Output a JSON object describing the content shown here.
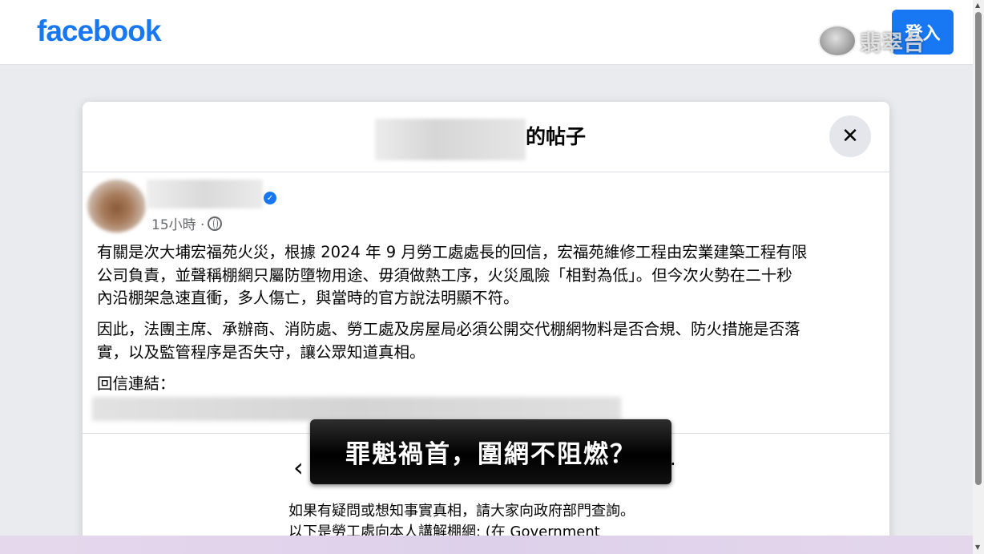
{
  "header": {
    "logo_text": "facebook",
    "login_label": "登入",
    "watermark_text": "翡翠台"
  },
  "modal": {
    "title_suffix": "的帖子",
    "close_icon": "close-icon"
  },
  "post": {
    "time": "15小時 ·",
    "privacy_icon": "globe-icon",
    "verified_icon": "verified-badge-icon",
    "paragraphs": [
      [
        "有關是次大埔宏福苑火災，根據 2024 年 9 月勞工處處長的回信，宏福苑維修工程由宏業建築工程有限",
        "公司負責，並聲稱棚網只屬防墮物用途、毋須做熱工序，火災風險「相對為低」。但今次火勢在二十秒",
        "內沿棚架急速直衝，多人傷亡，與當時的官方說法明顯不符。"
      ],
      [
        "因此，法團主席、承辦商、消防處、勞工處及房屋局必須公開交代棚網物料是否合規、防火措施是否落",
        "實，以及監管程序是否失守，讓公眾知道真相。"
      ],
      [
        "回信連結："
      ]
    ],
    "preview_lines": [
      "如果有疑問或想知事實真相，請大家向政府部門查詢。",
      "以下是勞工處向本人講解棚網: (在 Government"
    ]
  },
  "caption": {
    "text": "罪魁禍首，圍網不阻燃？"
  },
  "colors": {
    "brand": "#1877f2",
    "caption_bg": "#000000"
  }
}
